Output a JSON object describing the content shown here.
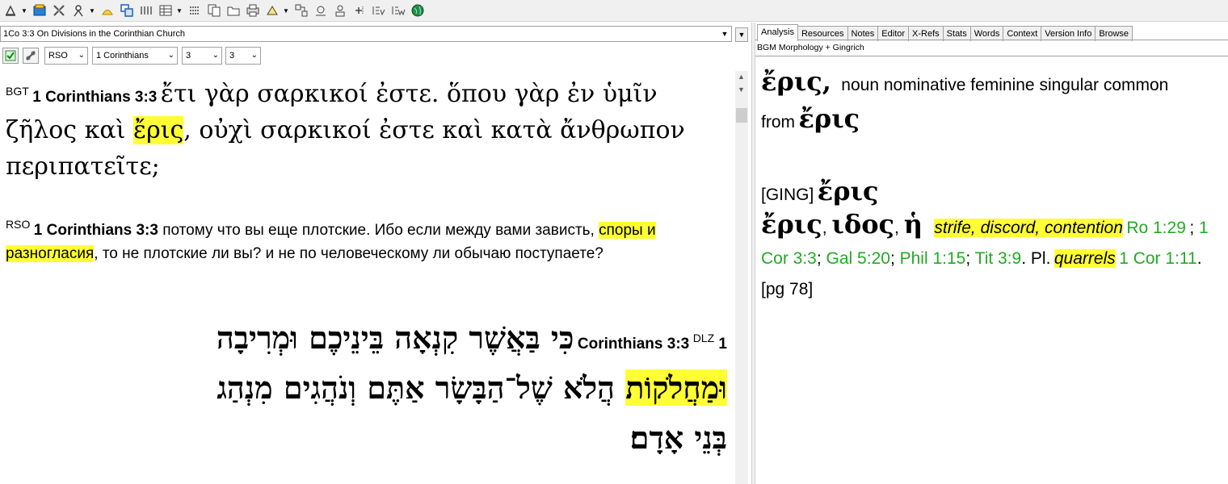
{
  "toolbar": {
    "items": [
      "search-icon",
      "open-icon",
      "tools-icon",
      "analysis-icon",
      "lamp-icon",
      "window-icon",
      "grid-icon",
      "layout-icon",
      "list-icon",
      "copy-icon",
      "folder-icon",
      "print-icon",
      "highlight-icon",
      "reference-icon",
      "stat-icon",
      "user-icon",
      "plus-icon",
      "ev-icon",
      "ew-icon",
      "globe-icon"
    ]
  },
  "left": {
    "passage_title": "1Co 3:3 On Divisions in the Corinthian Church",
    "version_combo": "RSO",
    "book_combo": "1 Corinthians",
    "chapter_combo": "3",
    "verse_combo": "3",
    "greek": {
      "abbr": "BGT",
      "ref": "1 Corinthians 3:3",
      "text_before": "ἔτι γὰρ σαρκικοί ἐστε. ὅπου γὰρ ἐν ὑμῖν ζῆλος καὶ ",
      "highlight": "ἔρις",
      "text_after": ", οὐχὶ σαρκικοί ἐστε καὶ κατὰ ἄνθρωπον περιπατεῖτε;"
    },
    "russian": {
      "abbr": "RSO",
      "ref": "1 Corinthians 3:3",
      "text_before": " потому что вы еще плотские. Ибо если между вами зависть, ",
      "highlight": "споры и разногласия",
      "text_after": ", то не плотские ли вы? и не по человеческому ли обычаю поступаете?"
    },
    "hebrew": {
      "abbr": "DLZ",
      "ref": "1 Corinthians 3:3",
      "line1": "כִּי בַּאֲשֶׁר קִנְאָה בֵּינֵיכֶם וּמְרִיבָה",
      "line2_highlight": "וּמַחֲלֹקוֹת",
      "line2_rest": "הֲלֹא שֶׁל־הַבָּשָׂר אַתֶּם וְנֹהֲגִים מִנְהַג",
      "line3": "בְּנֵי אָדָם׃"
    }
  },
  "right": {
    "tabs": [
      "Analysis",
      "Resources",
      "Notes",
      "Editor",
      "X-Refs",
      "Stats",
      "Words",
      "Context",
      "Version Info",
      "Browse"
    ],
    "source": "BGM Morphology + Gingrich",
    "word": "ἔρις,",
    "parse": "noun nominative feminine singular common",
    "from_label": "from",
    "lemma": "ἔρις",
    "ging_label": "[GING]",
    "ging_lemma": "ἔρις",
    "entry_head": "ἔρις",
    "entry_gen": "ιδος",
    "entry_art": "ἡ",
    "gloss": "strife, discord, contention",
    "refs1": [
      "Ro 1:29",
      "1 Cor 3:3",
      "Gal 5:20",
      "Phil 1:15",
      "Tit 3:9"
    ],
    "pl_label": "Pl.",
    "pl_gloss": "quarrels",
    "refs2": "1 Cor 1:11",
    "page": "[pg 78]"
  }
}
